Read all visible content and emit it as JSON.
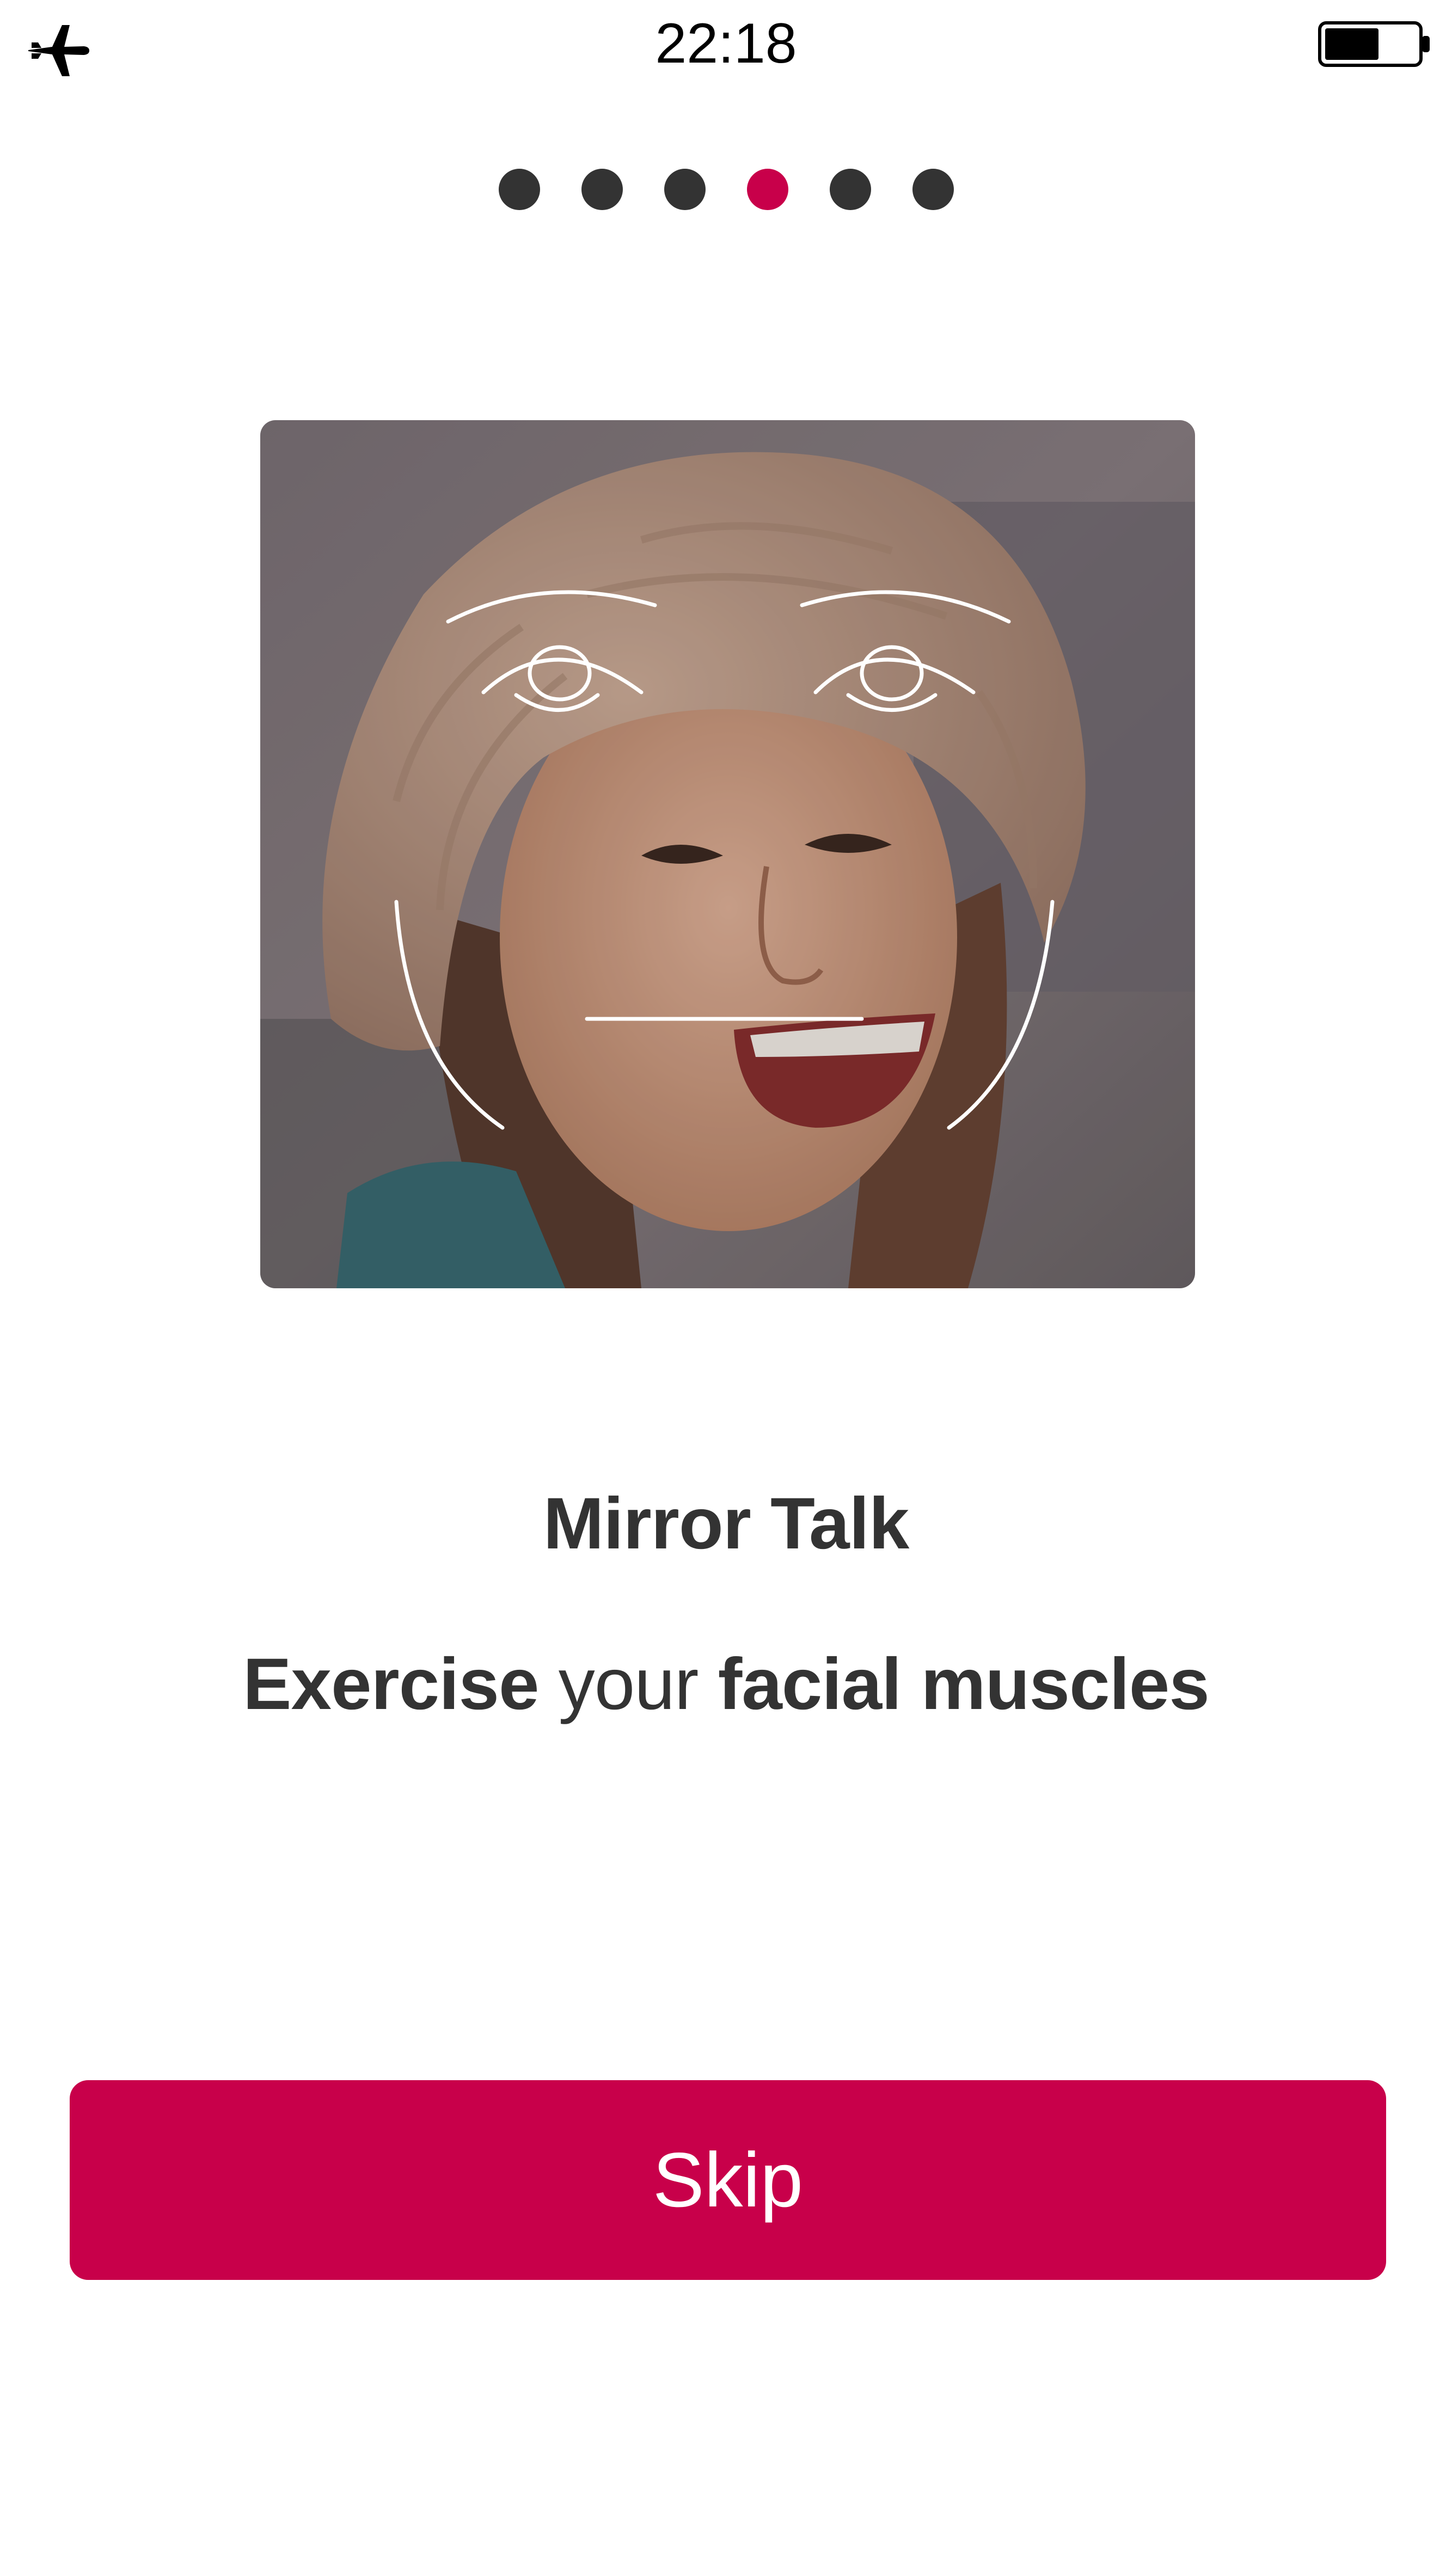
{
  "status_bar": {
    "time": "22:18",
    "icons": [
      "airplane-icon",
      "battery-icon"
    ],
    "battery_level": 0.55
  },
  "pager": {
    "total": 6,
    "active_index": 3,
    "colors": {
      "active": "#c8004a",
      "inactive": "#333333"
    }
  },
  "hero": {
    "image": "smiling-woman-photo",
    "overlay": "face-outline-guides"
  },
  "content": {
    "title": "Mirror Talk",
    "subtitle": {
      "part1": "Exercise",
      "part2": " your ",
      "part3": "facial muscles"
    }
  },
  "actions": {
    "skip_label": "Skip"
  },
  "colors": {
    "accent": "#c8004a",
    "text": "#333333",
    "background": "#ffffff"
  }
}
